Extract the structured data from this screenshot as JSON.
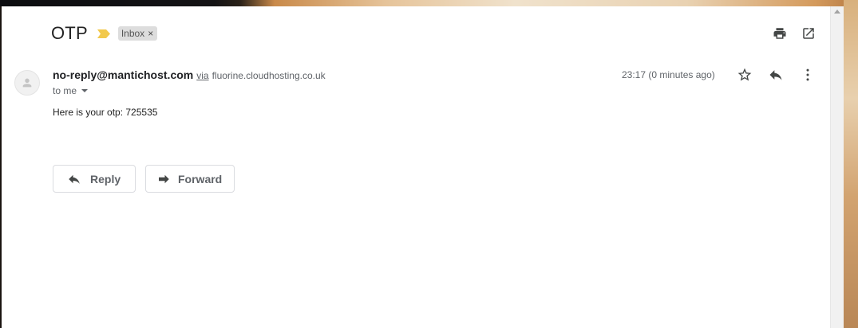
{
  "email": {
    "subject": "OTP",
    "label": "Inbox",
    "label_remove": "×",
    "sender_email": "no-reply@mantichost.com",
    "via_text": "via",
    "via_domain": "fluorine.cloudhosting.co.uk",
    "recipient_text": "to me",
    "timestamp": "23:17 (0 minutes ago)",
    "body": "Here is your otp: 725535"
  },
  "actions": {
    "reply_label": "Reply",
    "forward_label": "Forward"
  },
  "icons": {
    "importance": "importance-marker-icon",
    "print": "print-icon",
    "new_window": "open-in-new-window-icon",
    "star": "star-icon",
    "reply": "reply-icon",
    "more": "more-vert-icon",
    "avatar": "person-icon",
    "forward": "forward-icon"
  },
  "colors": {
    "importance_marker": "#f2c94c",
    "label_chip": "#dddddd",
    "icon_dark": "#444746",
    "text_secondary": "#5f6368"
  }
}
